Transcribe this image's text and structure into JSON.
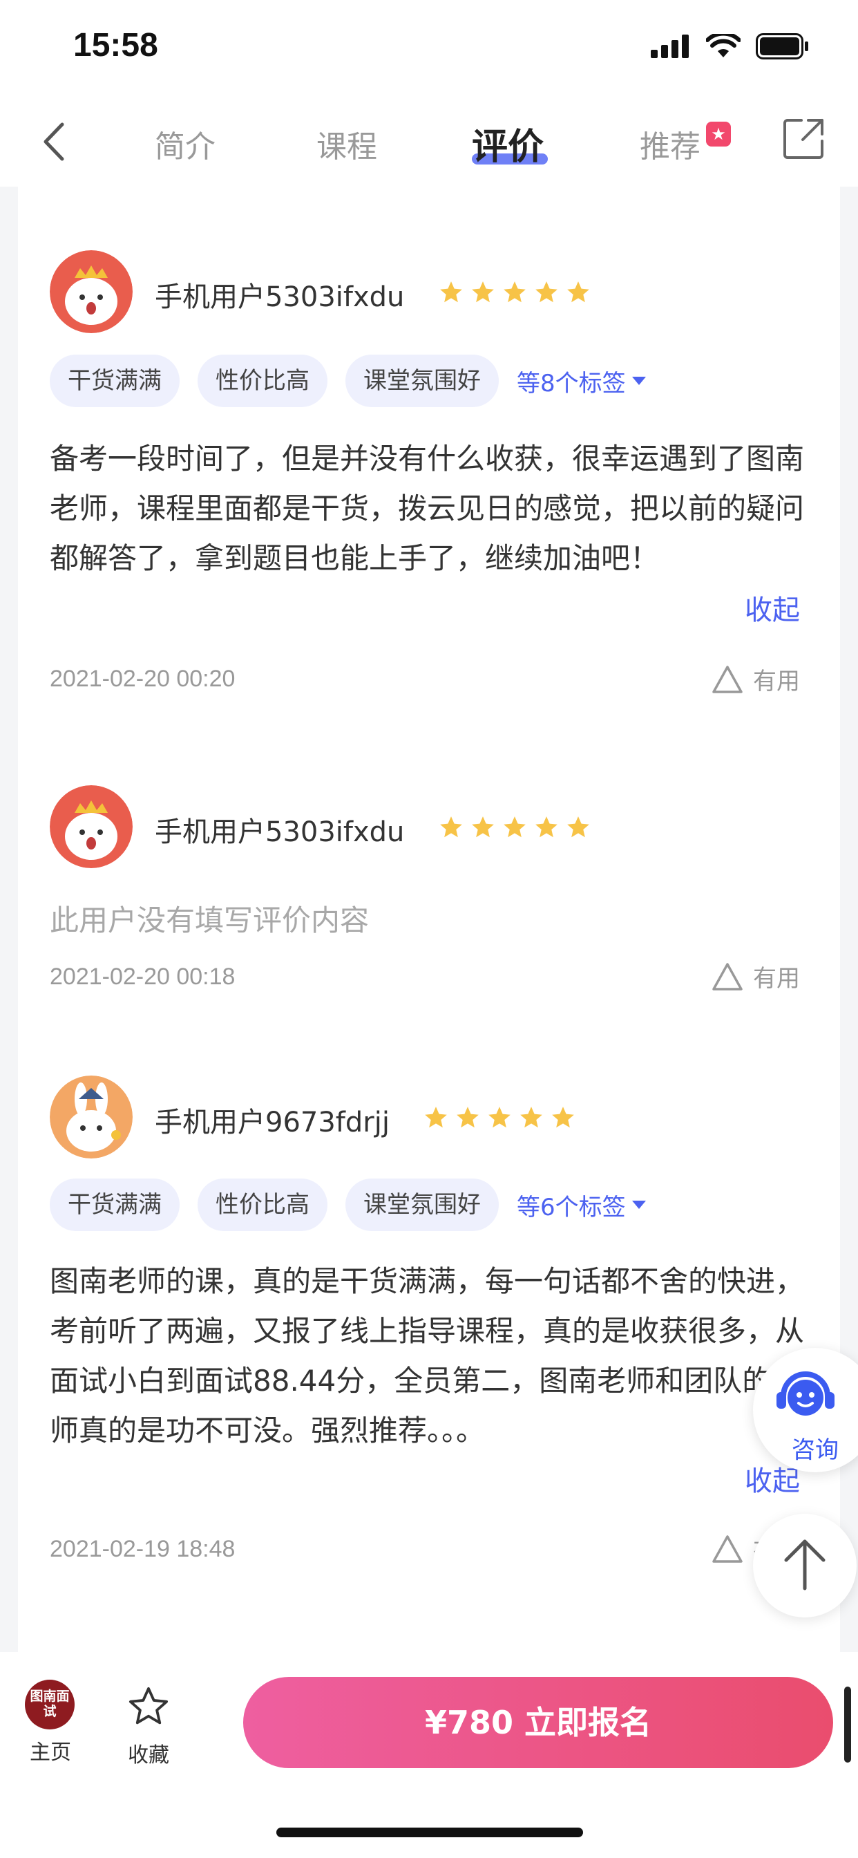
{
  "status_bar": {
    "time": "15:58"
  },
  "nav": {
    "tabs": [
      {
        "label": "简介"
      },
      {
        "label": "课程"
      },
      {
        "label": "评价"
      },
      {
        "label": "推荐"
      }
    ],
    "active_tab": "评价"
  },
  "reviews": [
    {
      "username": "手机用户5303ifxdu",
      "rating": 5,
      "tags": [
        "干货满满",
        "性价比高",
        "课堂氛围好"
      ],
      "more_tags": "等8个标签",
      "text": "备考一段时间了，但是并没有什么收获，很幸运遇到了图南老师，课程里面都是干货，拨云见日的感觉，把以前的疑问都解答了，拿到题目也能上手了，继续加油吧！",
      "collapse_label": "收起",
      "date": "2021-02-20 00:20",
      "useful_label": "有用"
    },
    {
      "username": "手机用户5303ifxdu",
      "rating": 5,
      "empty_text": "此用户没有填写评价内容",
      "date": "2021-02-20 00:18",
      "useful_label": "有用"
    },
    {
      "username": "手机用户9673fdrjj",
      "rating": 5,
      "tags": [
        "干货满满",
        "性价比高",
        "课堂氛围好"
      ],
      "more_tags": "等6个标签",
      "text": "图南老师的课，真的是干货满满，每一句话都不舍的快进，考前听了两遍，又报了线上指导课程，真的是收获很多，从面试小白到面试88.44分，全员第二，图南老师和团队的老师真的是功不可没。强烈推荐。。。",
      "collapse_label": "收起",
      "date": "2021-02-19 18:48",
      "useful_label": "有用"
    }
  ],
  "floating": {
    "consult_label": "咨询"
  },
  "bottom_bar": {
    "home_logo_text": "图南面试",
    "home_label": "主页",
    "favorite_label": "收藏",
    "enroll_label": "¥780 立即报名"
  },
  "colors": {
    "accent": "#4c62f0",
    "star": "#f7c347",
    "enroll_gradient_start": "#ee5fa0",
    "enroll_gradient_end": "#ea4d6e",
    "logo": "#8e1b20"
  }
}
